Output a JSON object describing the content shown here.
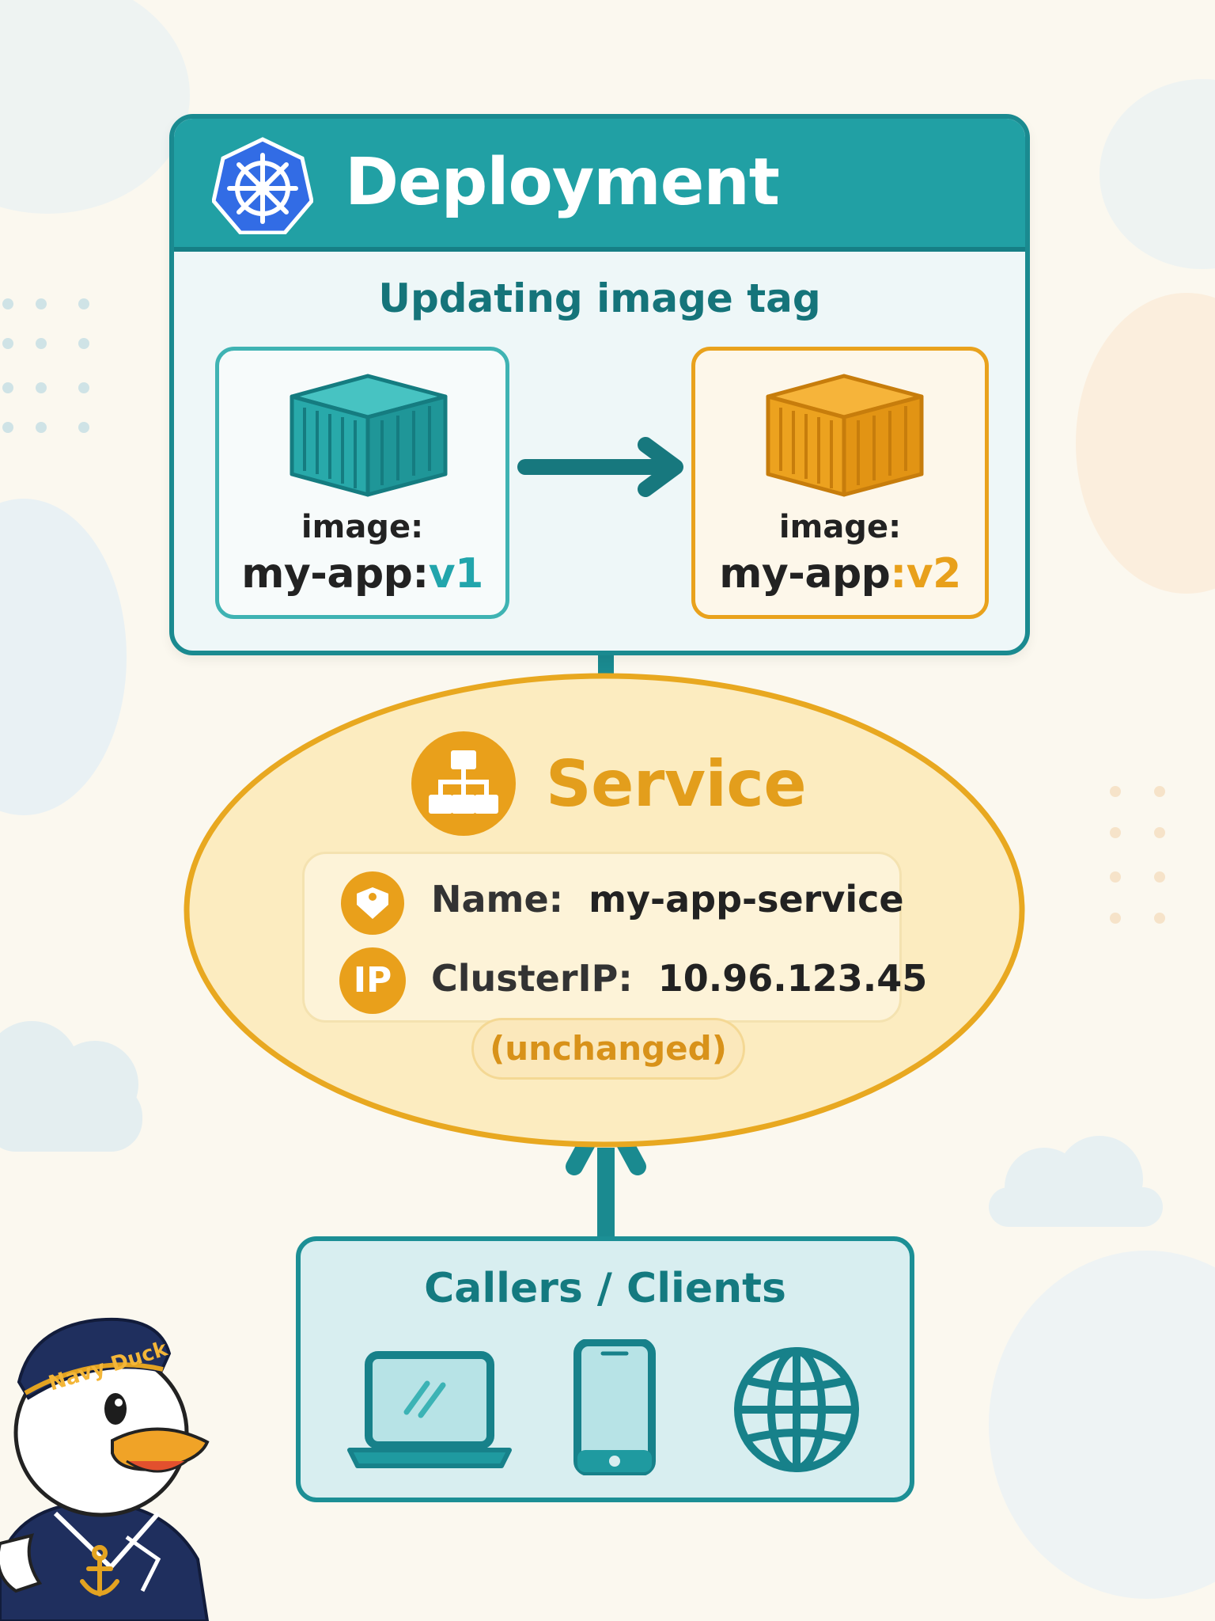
{
  "deployment": {
    "title": "Deployment",
    "subtitle": "Updating image tag",
    "old_image": {
      "label": "image:",
      "name": "my-app",
      "tag": "v1"
    },
    "new_image": {
      "label": "image:",
      "name": "my-app",
      "tag": "v2"
    }
  },
  "service": {
    "title": "Service",
    "name_key": "Name:",
    "name_value": "my-app-service",
    "ip_badge": "IP",
    "ip_key": "ClusterIP:",
    "ip_value": "10.96.123.45",
    "note": "(unchanged)"
  },
  "clients": {
    "title": "Callers / Clients",
    "devices": [
      "laptop-icon",
      "phone-icon",
      "globe-icon"
    ]
  },
  "mascot": {
    "hat_text": "Navy Duck"
  },
  "colors": {
    "teal": "#21a0a4",
    "teal_dark": "#167f85",
    "orange": "#e9a21d",
    "ellipse_fill": "#fcecc0",
    "ellipse_stroke": "#e8a820",
    "kubernetes_blue": "#326ce5"
  }
}
